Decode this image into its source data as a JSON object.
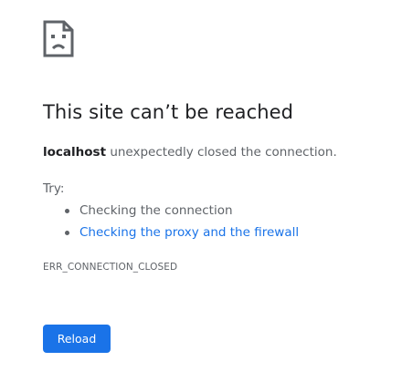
{
  "error": {
    "icon": "sad-page-icon",
    "title": "This site can’t be reached",
    "host": "localhost",
    "message": " unexpectedly closed the connection.",
    "try_label": "Try:",
    "suggestions": [
      {
        "label": "Checking the connection",
        "is_link": false
      },
      {
        "label": "Checking the proxy and the firewall",
        "is_link": true
      }
    ],
    "code": "ERR_CONNECTION_CLOSED"
  },
  "actions": {
    "reload_label": "Reload"
  },
  "colors": {
    "accent": "#1a73e8",
    "text_primary": "#202124",
    "text_secondary": "#5f6368"
  }
}
